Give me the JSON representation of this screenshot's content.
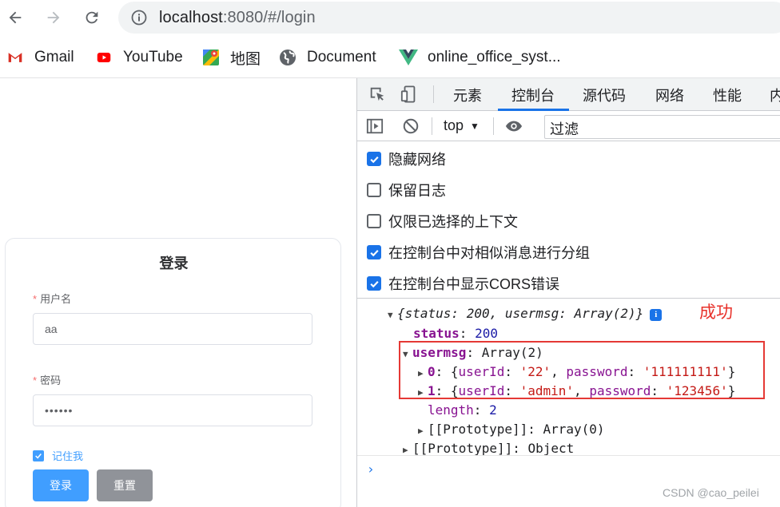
{
  "browser": {
    "url_host": "localhost",
    "url_rest": ":8080/#/login",
    "bookmarks": [
      {
        "label": "Gmail",
        "icon": "gmail-icon"
      },
      {
        "label": "YouTube",
        "icon": "youtube-icon"
      },
      {
        "label": "地图",
        "icon": "maps-icon"
      },
      {
        "label": "Document",
        "icon": "globe-icon"
      },
      {
        "label": "online_office_syst...",
        "icon": "vue-icon"
      }
    ]
  },
  "login": {
    "title": "登录",
    "username_label": "用户名",
    "username_value": "aa",
    "password_label": "密码",
    "password_value": "••••••",
    "required_mark": "*",
    "remember_label": "记住我",
    "login_button": "登录",
    "reset_button": "重置"
  },
  "devtools": {
    "tabs": [
      "元素",
      "控制台",
      "源代码",
      "网络",
      "性能",
      "内"
    ],
    "active_tab": "控制台",
    "context": "top",
    "filter_placeholder": "过滤",
    "settings": [
      {
        "label": "隐藏网络",
        "checked": true
      },
      {
        "label": "保留日志",
        "checked": false
      },
      {
        "label": "仅限已选择的上下文",
        "checked": false
      },
      {
        "label": "在控制台中对相似消息进行分组",
        "checked": true
      },
      {
        "label": "在控制台中显示CORS错误",
        "checked": true
      }
    ],
    "console": {
      "summary": "{status: 200, usermsg: Array(2)}",
      "annotation": "成功",
      "status_key": "status",
      "status_value": "200",
      "usermsg_key": "usermsg",
      "usermsg_value": "Array(2)",
      "item0_index": "0",
      "item0_userId": "'22'",
      "item0_password": "'111111111'",
      "item1_index": "1",
      "item1_userId": "'admin'",
      "item1_password": "'123456'",
      "userId_key": "userId",
      "password_key": "password",
      "length_key": "length",
      "length_value": "2",
      "proto_key": "[[Prototype]]",
      "proto_array": "Array(0)",
      "proto_object": "Object",
      "prompt": "›"
    }
  },
  "watermark": "CSDN @cao_peilei",
  "colors": {
    "accent": "#1a73e8",
    "element_primary": "#409eff",
    "annotation_red": "#e53935"
  }
}
